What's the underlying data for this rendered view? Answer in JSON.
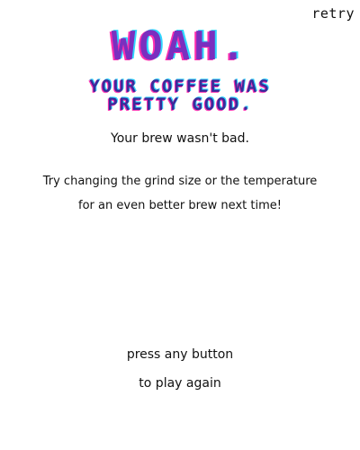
{
  "retry_label": "retry",
  "headline": "WOAH.",
  "subheadline": {
    "line1": "YOUR COFFEE WAS",
    "line2": "PRETTY GOOD."
  },
  "verdict": "Your brew wasn't bad.",
  "tip": {
    "line1": "Try changing the grind size or the temperature",
    "line2": "for an even better brew next time!"
  },
  "prompt": {
    "line1": "press any button",
    "line2": "to play again"
  },
  "colors": {
    "headline": "#7a2fbf",
    "subheadline": "#3a2b9a",
    "glitch_pink": "#ff2fb0",
    "glitch_cyan": "#2fd6ff",
    "text": "#111111",
    "background": "#ffffff"
  }
}
